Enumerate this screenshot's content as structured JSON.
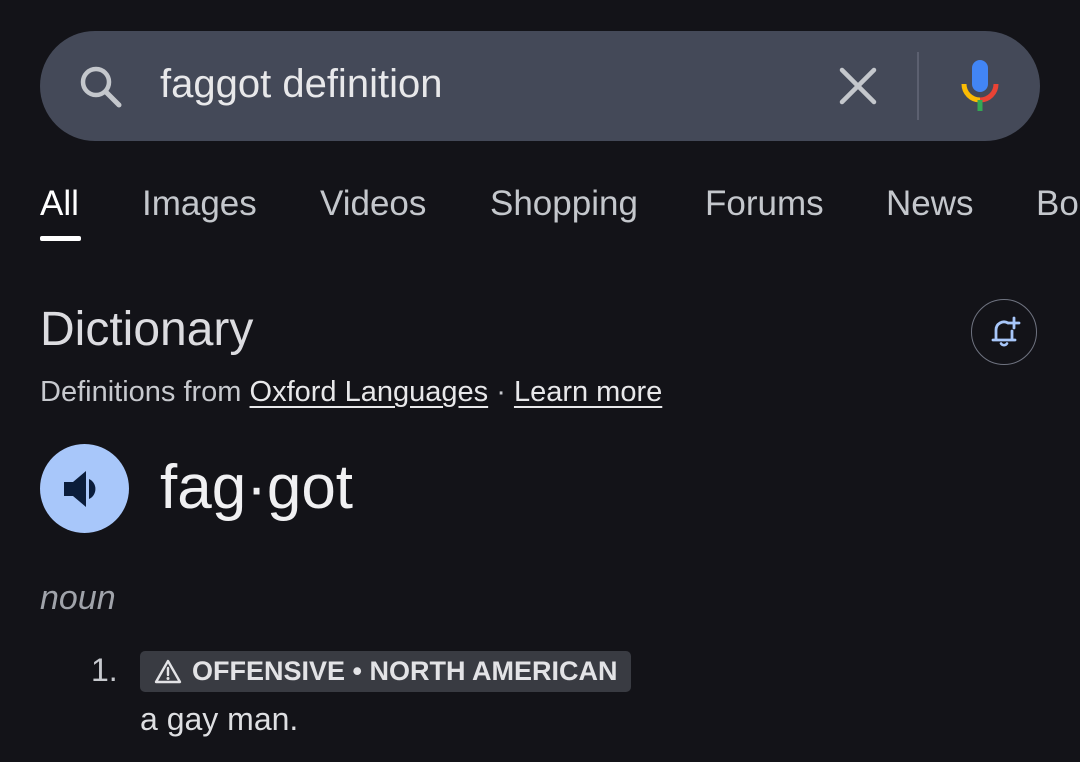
{
  "search": {
    "query": "faggot definition"
  },
  "tabs": [
    {
      "label": "All",
      "active": true
    },
    {
      "label": "Images"
    },
    {
      "label": "Videos"
    },
    {
      "label": "Shopping"
    },
    {
      "label": "Forums"
    },
    {
      "label": "News"
    },
    {
      "label": "Bo"
    }
  ],
  "dictionary": {
    "title": "Dictionary",
    "source_prefix": "Definitions from",
    "source_link": "Oxford Languages",
    "separator": "·",
    "learn_more": "Learn more",
    "headword": "fag·got",
    "part_of_speech": "noun",
    "definitions": [
      {
        "number": "1.",
        "label": "OFFENSIVE • NORTH AMERICAN",
        "text": "a gay man."
      }
    ]
  },
  "colors": {
    "background": "#131318",
    "search_bar": "#444958",
    "speaker_button": "#a8c7fa",
    "label_chip": "#393b42"
  },
  "icons": [
    "search-icon",
    "close-icon",
    "microphone-icon",
    "bell-plus-icon",
    "speaker-icon",
    "warning-icon"
  ]
}
